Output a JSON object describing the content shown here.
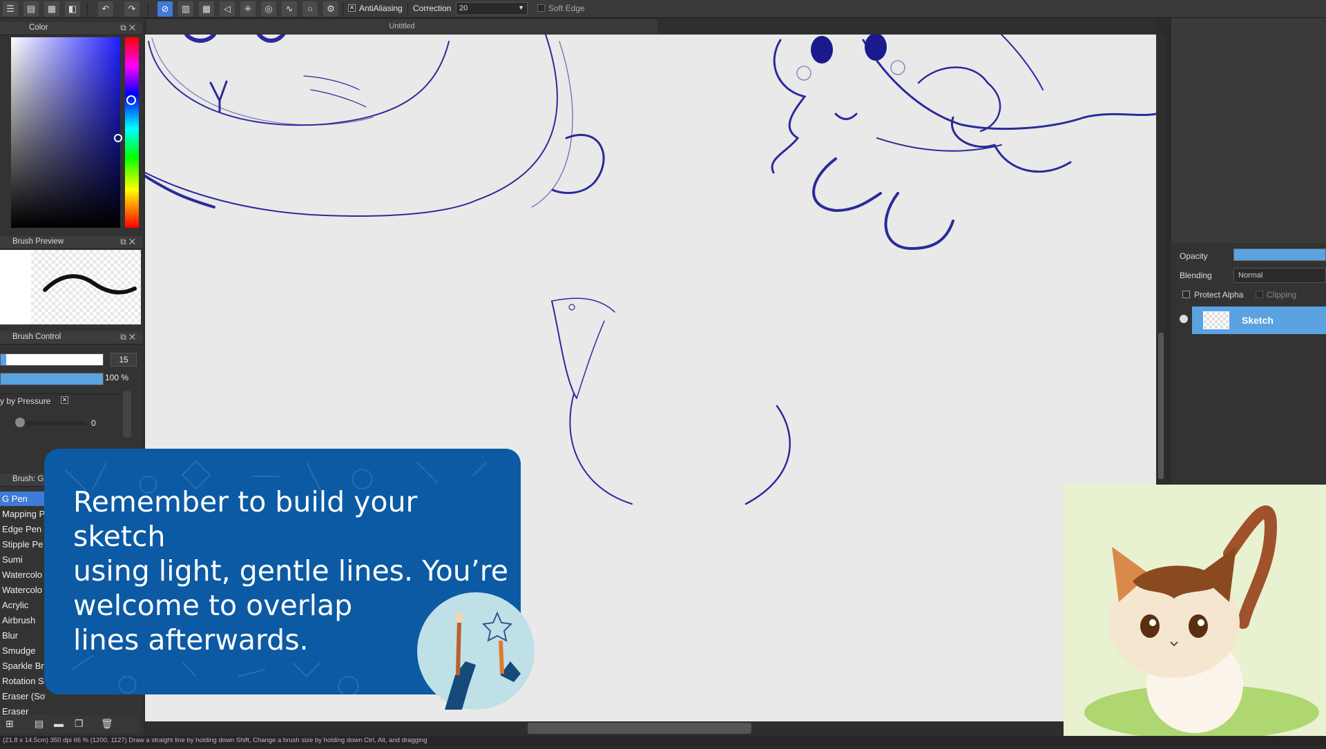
{
  "toolbar": {
    "antialiasing_label": "AntiAliasing",
    "correction_label": "Correction",
    "correction_value": "20",
    "soft_edge_label": "Soft Edge"
  },
  "canvas_tab": {
    "title": "Untitled"
  },
  "panels": {
    "color": {
      "title": "Color"
    },
    "brush_preview": {
      "title": "Brush Preview"
    },
    "brush_control": {
      "title": "Brush Control",
      "size_value": "15",
      "opacity_value": "100 %",
      "by_pressure_label": "y by Pressure",
      "pressure_slider_value": "0"
    },
    "brush_list": {
      "title": "Brush: G",
      "items": [
        "G Pen",
        "Mapping P",
        "Edge Pen",
        "Stipple Pe",
        "Sumi",
        "Watercolo",
        "Watercolo",
        "Acrylic",
        "Airbrush",
        "Blur",
        "Smudge",
        "Sparkle Br",
        "Rotation S",
        "Eraser (Soft)",
        "Eraser"
      ],
      "selected": "G Pen"
    }
  },
  "layers": {
    "opacity_label": "Opacity",
    "blending_label": "Blending",
    "blending_value": "Normal",
    "protect_alpha_label": "Protect Alpha",
    "clipping_label": "Clipping",
    "layer_name": "Sketch"
  },
  "overlay": {
    "lines": [
      "Remember to build your sketch",
      "using light, gentle lines. You’re",
      "welcome to overlap",
      "lines afterwards."
    ]
  },
  "statusbar": {
    "text": "(21.8 x 14.5cm) 350 dpi 66 % (1200, 1127) Draw a straight line by holding down Shift, Change a brush size by holding down Ctrl, Alt, and dragging"
  },
  "colors": {
    "accent": "#3d7bd6",
    "card_blue": "#0b5aa3",
    "sketch_stroke": "#1a1a8c",
    "canvas_bg": "#e9e9e9"
  }
}
